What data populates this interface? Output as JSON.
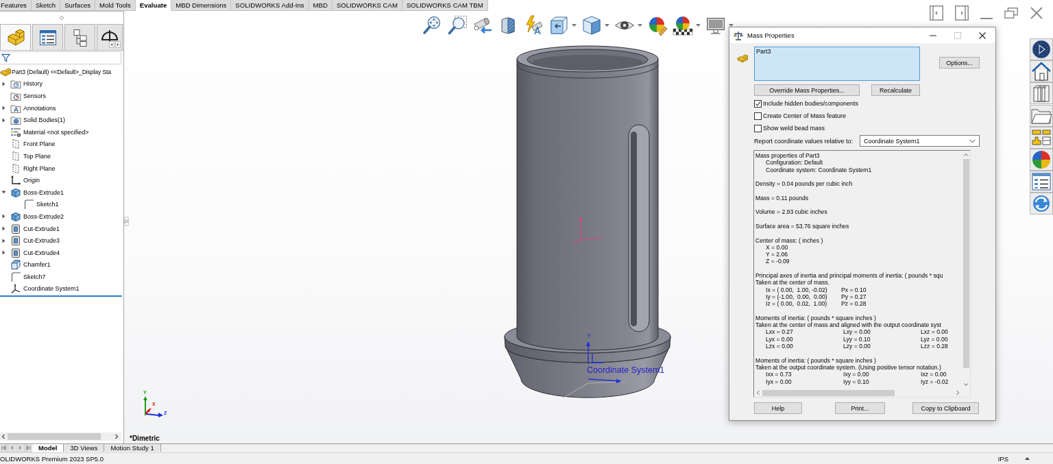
{
  "top_tabs": [
    {
      "label": "Features",
      "selected": false
    },
    {
      "label": "Sketch",
      "selected": false
    },
    {
      "label": "Surfaces",
      "selected": false
    },
    {
      "label": "Mold Tools",
      "selected": false
    },
    {
      "label": "Evaluate",
      "selected": true
    },
    {
      "label": "MBD Dimensions",
      "selected": false
    },
    {
      "label": "SOLIDWORKS Add-Ins",
      "selected": false
    },
    {
      "label": "MBD",
      "selected": false
    },
    {
      "label": "SOLIDWORKS CAM",
      "selected": false
    },
    {
      "label": "SOLIDWORKS CAM TBM",
      "selected": false
    }
  ],
  "heads_up_toolbar": [
    {
      "kind": "zoom-fit",
      "dropdown": false
    },
    {
      "kind": "zoom-area",
      "dropdown": false
    },
    {
      "kind": "previous-view",
      "dropdown": false
    },
    {
      "kind": "section-view",
      "dropdown": false
    },
    {
      "kind": "dynamic-annotation",
      "dropdown": false
    },
    {
      "kind": "view-orientation",
      "dropdown": true
    },
    {
      "kind": "display-style",
      "dropdown": true
    },
    {
      "kind": "hide-show",
      "dropdown": true
    },
    {
      "kind": "edit-appearance",
      "dropdown": false
    },
    {
      "kind": "apply-scene",
      "dropdown": true
    },
    {
      "kind": "view-settings",
      "dropdown": true
    }
  ],
  "document_controls": [
    {
      "kind": "tile-left"
    },
    {
      "kind": "tile-right"
    },
    {
      "kind": "minimize"
    },
    {
      "kind": "restore"
    },
    {
      "kind": "close"
    }
  ],
  "manager_tabs": [
    {
      "kind": "feature-manager",
      "selected": true
    },
    {
      "kind": "property-manager",
      "selected": false
    },
    {
      "kind": "configuration-manager",
      "selected": false
    },
    {
      "kind": "dimxpert-manager",
      "selected": false
    }
  ],
  "feature_tree": {
    "root": {
      "kind": "part",
      "label": "Part3 (Default) <<Default>_Display Sta",
      "selected": false
    },
    "items": [
      {
        "kind": "history",
        "label": "History",
        "expanded": false,
        "selected": false
      },
      {
        "kind": "sensors",
        "label": "Sensors",
        "selected": false
      },
      {
        "kind": "annotations",
        "label": "Annotations",
        "expanded": false,
        "selected": false
      },
      {
        "kind": "solid-bodies",
        "label": "Solid Bodies(1)",
        "expanded": false,
        "selected": false
      },
      {
        "kind": "material",
        "label": "Material <not specified>",
        "selected": false
      },
      {
        "kind": "plane",
        "label": "Front Plane",
        "selected": false
      },
      {
        "kind": "plane",
        "label": "Top Plane",
        "selected": false
      },
      {
        "kind": "plane",
        "label": "Right Plane",
        "selected": false
      },
      {
        "kind": "origin",
        "label": "Origin",
        "selected": false
      },
      {
        "kind": "boss-extrude",
        "label": "Boss-Extrude1",
        "expanded": true,
        "selected": false,
        "children": [
          {
            "kind": "sketch",
            "label": "Sketch1",
            "selected": false
          }
        ]
      },
      {
        "kind": "boss-extrude",
        "label": "Boss-Extrude2",
        "expanded": false,
        "selected": false
      },
      {
        "kind": "cut-extrude",
        "label": "Cut-Extrude1",
        "expanded": false,
        "selected": false
      },
      {
        "kind": "cut-extrude",
        "label": "Cut-Extrude3",
        "expanded": false,
        "selected": false
      },
      {
        "kind": "cut-extrude",
        "label": "Cut-Extrude4",
        "expanded": false,
        "selected": false
      },
      {
        "kind": "chamfer",
        "label": "Chamfer1",
        "selected": false
      },
      {
        "kind": "sketch",
        "label": "Sketch7",
        "selected": false
      },
      {
        "kind": "coordinate-system",
        "label": "Coordinate System1",
        "selected": false
      }
    ]
  },
  "viewport": {
    "axis_label": "Y",
    "coordinate_system_label": "Coordinate System1",
    "triad": [
      {
        "label": "Y",
        "color": "#1f9a1f"
      },
      {
        "label": "X",
        "color": "#d21a1a"
      },
      {
        "label": "Z",
        "color": "#1a2fd8"
      }
    ],
    "view_name": "*Dimetric"
  },
  "task_pane": [
    {
      "kind": "disc"
    },
    {
      "kind": "house"
    },
    {
      "kind": "books"
    },
    {
      "kind": "folder"
    },
    {
      "kind": "blocks"
    },
    {
      "kind": "sphere"
    },
    {
      "kind": "list"
    },
    {
      "kind": "refresh"
    }
  ],
  "mass_properties": {
    "title": "Mass Properties",
    "title_buttons": [
      {
        "kind": "minimize",
        "disabled": false
      },
      {
        "kind": "maximize",
        "disabled": true
      },
      {
        "kind": "close",
        "disabled": false
      }
    ],
    "selection": [
      "Part3"
    ],
    "options_button": "Options...",
    "override_button": "Override Mass Properties...",
    "recalculate_button": "Recalculate",
    "checkboxes": [
      {
        "label": "Include hidden bodies/components",
        "checked": true
      },
      {
        "label": "Create Center of Mass feature",
        "checked": false
      },
      {
        "label": "Show weld bead mass",
        "checked": false
      }
    ],
    "coordinate_label": "Report coordinate values relative to:",
    "coordinate_system": "Coordinate System1",
    "report": [
      {
        "lines": [
          "Mass properties of Part3"
        ],
        "rows": [
          [
            "Configuration: Default"
          ],
          [
            "Coordinate system: Coordinate System1"
          ]
        ]
      },
      {
        "lines": [
          "Density = 0.04 pounds per cubic inch"
        ]
      },
      {
        "lines": [
          "Mass = 0.11 pounds"
        ]
      },
      {
        "lines": [
          "Volume = 2.93 cubic inches"
        ]
      },
      {
        "lines": [
          "Surface area = 53.76 square inches"
        ]
      },
      {
        "lines": [
          "Center of mass: ( inches )"
        ],
        "rows": [
          [
            "X = 0.00"
          ],
          [
            "Y = 2.06"
          ],
          [
            "Z = -0.09"
          ]
        ]
      },
      {
        "lines": [
          "Principal axes of inertia and principal moments of inertia: ( pounds * squ",
          "Taken at the center of mass."
        ],
        "rows": [
          [
            "Ix = ( 0.00,  1.00, -0.02)",
            "Px = 0.10"
          ],
          [
            "Iy = (-1.00,  0.00,  0.00)",
            "Py = 0.27"
          ],
          [
            "Iz = ( 0.00,  0.02,  1.00)",
            "Pz = 0.28"
          ]
        ]
      },
      {
        "lines": [
          "Moments of inertia: ( pounds * square inches )",
          "Taken at the center of mass and aligned with the output coordinate syst"
        ],
        "rows": [
          [
            "Lxx = 0.27",
            "Lxy = 0.00",
            "Lxz = 0.00"
          ],
          [
            "Lyx = 0.00",
            "Lyy = 0.10",
            "Lyz = 0.00"
          ],
          [
            "Lzx = 0.00",
            "Lzy = 0.00",
            "Lzz = 0.28"
          ]
        ]
      },
      {
        "lines": [
          "Moments of inertia: ( pounds * square inches )",
          "Taken at the output coordinate system. (Using positive tensor notation.)"
        ],
        "rows": [
          [
            "Ixx = 0.73",
            "Ixy = 0.00",
            "Ixz = 0.00"
          ],
          [
            "Iyx = 0.00",
            "Iyy = 0.10",
            "Iyz = -0.02"
          ]
        ]
      }
    ],
    "buttons": [
      "Help",
      "Print...",
      "Copy to Clipboard"
    ]
  },
  "bottom_tabs": [
    {
      "label": "Model",
      "selected": true
    },
    {
      "label": "3D Views",
      "selected": false
    },
    {
      "label": "Motion Study 1",
      "selected": false
    }
  ],
  "status_bar": {
    "product": "OLIDWORKS Premium 2023 SP5.0",
    "units": "IPS"
  }
}
